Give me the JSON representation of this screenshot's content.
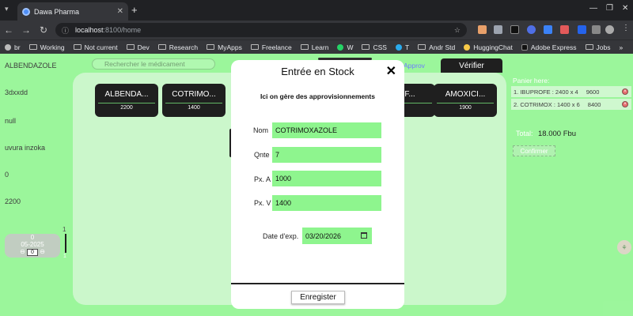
{
  "browser": {
    "tab_title": "Dawa Pharma",
    "new_tab": "+",
    "url_host": "localhost",
    "url_path": ":8100/home",
    "bookmarks": [
      "br",
      "Working",
      "Not current",
      "Dev",
      "Research",
      "MyApps",
      "Freelance",
      "Learn",
      "W",
      "CSS",
      "T",
      "Andr Std",
      "HuggingChat",
      "Adobe Express",
      "Jobs"
    ],
    "more": "»"
  },
  "left": {
    "drug_name": "ALBENDAZOLE",
    "code": "3dxxdd",
    "null_text": "null",
    "note": "uvura inzoka",
    "zero": "0",
    "price": "2200",
    "box_qty": "0",
    "box_date": "05-2025",
    "box_input": "0",
    "side_num": "1",
    "side_num2": "1"
  },
  "search": {
    "placeholder": "Rechercher le médicament"
  },
  "tabs": {
    "approv": "Approv",
    "verify": "Vérifier"
  },
  "cards": [
    {
      "name": "ALBENDA...",
      "price": "2200"
    },
    {
      "name": "COTRIMO...",
      "price": "1400"
    },
    {
      "name": "...OF...",
      "price": ""
    },
    {
      "name": "AMOXICI...",
      "price": "1900"
    }
  ],
  "cart": {
    "title": "Panier here:",
    "items": [
      {
        "label": "1. IBUPROFE : 2400 x 4",
        "amount": "9600"
      },
      {
        "label": "2. COTRIMOX : 1400 x 6",
        "amount": "8400"
      }
    ],
    "total_label": "Total:",
    "total_value": "18.000 Fbu",
    "confirm": "Confirmer"
  },
  "modal": {
    "title": "Entrée en Stock",
    "close": "✕",
    "subtitle": "Ici on gère des approvisionnements",
    "fields": [
      {
        "label": "Nom",
        "value": "COTRIMOXAZOLE"
      },
      {
        "label": "Qnte",
        "value": "7"
      },
      {
        "label": "Px. A",
        "value": "1000"
      },
      {
        "label": "Px. V",
        "value": "1400"
      }
    ],
    "date_label": "Date d'exp.",
    "date_value": "03/20/2026",
    "save": "Enregister"
  }
}
